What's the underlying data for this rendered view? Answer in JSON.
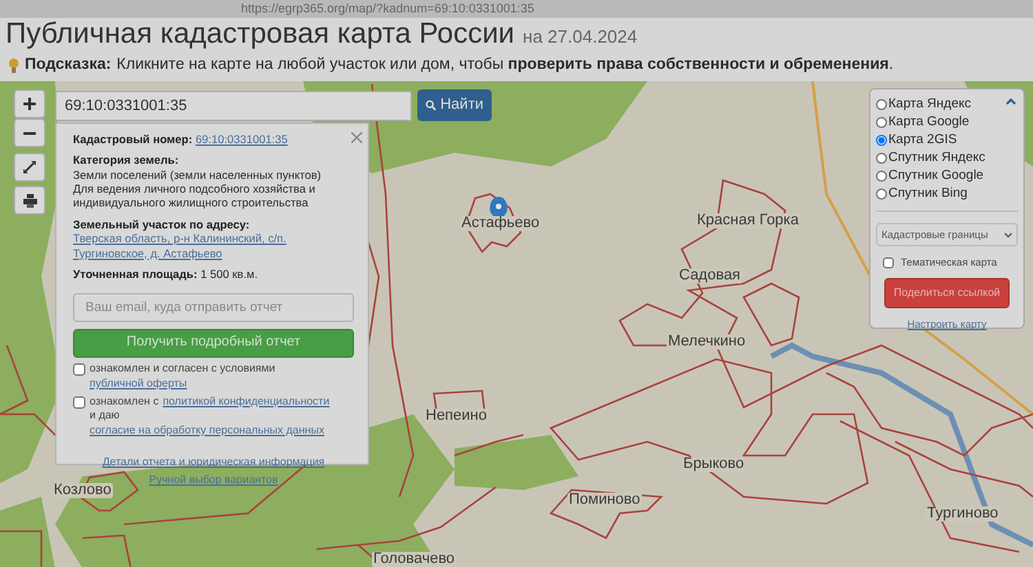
{
  "browser": {
    "url": "https://egrp365.org/map/?kadnum=69:10:0331001:35"
  },
  "header": {
    "title": "Публичная кадастровая карта России",
    "date": "на 27.04.2024"
  },
  "hint": {
    "label": "Подсказка:",
    "text": "Кликните на карте на любой участок или дом, чтобы **проверить права собственности и обременения**."
  },
  "search": {
    "value": "69:10:0331001:35",
    "button": "Найти"
  },
  "popup": {
    "fields": [
      {
        "label": "Кадастровый номер:",
        "value": "69:10:0331001:35",
        "link": true
      },
      {
        "label": "Категория земель:",
        "value": "Земли поселений (земли населенных пунктов)",
        "note": "Для ведения личного подсобного хозяйства и индивидуального жилищного строительства",
        "link": false
      },
      {
        "label": "Земельный участок по адресу:",
        "value": "Тверская область, р-н Калининский, с/п. Тургиновское, д. Астафьево",
        "link": true
      },
      {
        "label": "Уточненная площадь:",
        "value": "1 500 кв.м.",
        "link": false
      }
    ],
    "email_placeholder": "Ваш email, куда отправить отчет",
    "submit": "Получить подробный отчет",
    "consents": [
      {
        "checked": false,
        "parts": [
          {
            "text": "ознакомлен и согласен с условиями",
            "link": false
          },
          {
            "text": "публичной оферты",
            "link": true
          }
        ]
      },
      {
        "checked": false,
        "parts": [
          {
            "text": "ознакомлен с",
            "link": false
          },
          {
            "text": "политикой конфиденциальности",
            "link": true
          },
          {
            "text": "и даю",
            "link": false
          },
          {
            "text": "согласие на обработку персональных данных",
            "link": true
          }
        ]
      }
    ],
    "links": [
      "Детали отчета и юридическая информация",
      "Ручной выбор вариантов"
    ]
  },
  "layers": {
    "options": [
      {
        "label": "Карта Яндекс",
        "selected": false
      },
      {
        "label": "Карта Google",
        "selected": false
      },
      {
        "label": "Карта 2GIS",
        "selected": true
      },
      {
        "label": "Спутник Яндекс",
        "selected": false
      },
      {
        "label": "Спутник Google",
        "selected": false
      },
      {
        "label": "Спутник Bing",
        "selected": false
      }
    ],
    "select": "Кадастровые границы",
    "thematic": {
      "label": "Тематическая карта",
      "checked": false
    },
    "share": "Поделиться ссылкой",
    "settings": "Настроить карту"
  },
  "map": {
    "labels": [
      {
        "text": "Астафьево"
      },
      {
        "text": "Красная Горка"
      },
      {
        "text": "Садовая"
      },
      {
        "text": "Мелечкино"
      },
      {
        "text": "Непеино"
      },
      {
        "text": "Брыково"
      },
      {
        "text": "Поминово"
      },
      {
        "text": "Тургиново"
      },
      {
        "text": "Козлово"
      },
      {
        "text": "Головачево"
      }
    ]
  }
}
